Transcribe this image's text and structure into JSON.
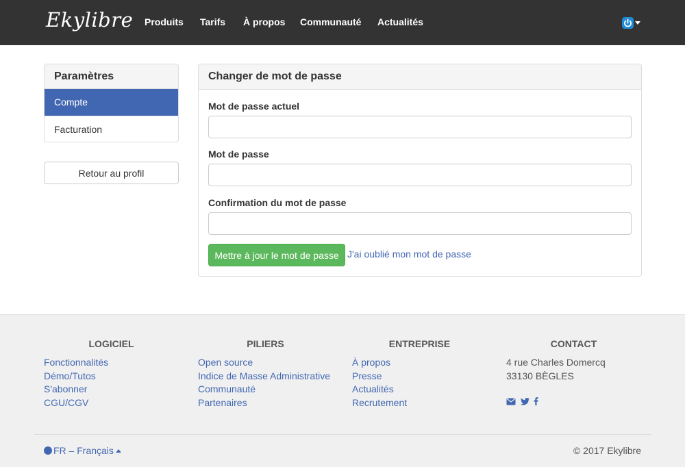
{
  "nav": {
    "brand": "Ekylibre",
    "links": [
      "Produits",
      "Tarifs",
      "À propos",
      "Communauté",
      "Actualités"
    ]
  },
  "sidebar": {
    "title": "Paramètres",
    "items": [
      {
        "label": "Compte",
        "active": true
      },
      {
        "label": "Facturation",
        "active": false
      }
    ],
    "back_button": "Retour au profil"
  },
  "main": {
    "title": "Changer de mot de passe",
    "fields": [
      {
        "label": "Mot de passe actuel",
        "value": ""
      },
      {
        "label": "Mot de passe",
        "value": ""
      },
      {
        "label": "Confirmation du mot de passe",
        "value": ""
      }
    ],
    "submit": "Mettre à jour le mot de passe",
    "forgot": "J'ai oublié mon mot de passe"
  },
  "footer": {
    "columns": [
      {
        "title": "LOGICIEL",
        "links": [
          "Fonctionnalités",
          "Démo/Tutos",
          "S'abonner",
          "CGU/CGV"
        ]
      },
      {
        "title": "PILIERS",
        "links": [
          "Open source",
          "Indice de Masse Administrative",
          "Communauté",
          "Partenaires"
        ]
      },
      {
        "title": "ENTREPRISE",
        "links": [
          "À propos",
          "Presse",
          "Actualités",
          "Recrutement"
        ]
      },
      {
        "title": "CONTACT",
        "lines": [
          "4 rue Charles Domercq",
          "33130 BÈGLES"
        ]
      }
    ],
    "social_icons": [
      "envelope-icon",
      "twitter-icon",
      "facebook-icon"
    ],
    "language": "FR – Français",
    "copyright": "© 2017 Ekylibre"
  },
  "colors": {
    "navbar": "#333333",
    "active": "#4267b2",
    "link": "#4267b2",
    "success": "#5cb85c",
    "footer_bg": "#f0f0f0"
  }
}
